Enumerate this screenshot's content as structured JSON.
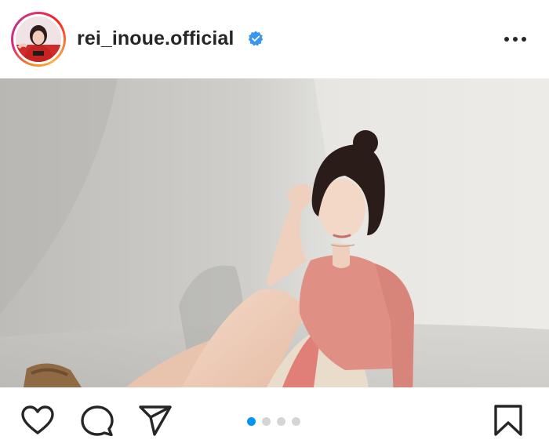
{
  "post": {
    "username": "rei_inoue.official",
    "verified": true,
    "carousel": {
      "total_slides": 4,
      "active_slide": 1
    }
  },
  "icons": {
    "avatar": "profile-avatar",
    "verified": "verified-badge-icon",
    "more": "more-options-icon",
    "like": "heart-icon",
    "comment": "comment-bubble-icon",
    "share": "paper-plane-icon",
    "save": "bookmark-icon"
  },
  "colors": {
    "story_ring": [
      "#f58529",
      "#dd2a7b",
      "#fcaf45"
    ],
    "verified_blue": "#3897f0",
    "active_dot": "#0095f6",
    "inactive_dot": "#d5d5d5",
    "text": "#262626"
  }
}
